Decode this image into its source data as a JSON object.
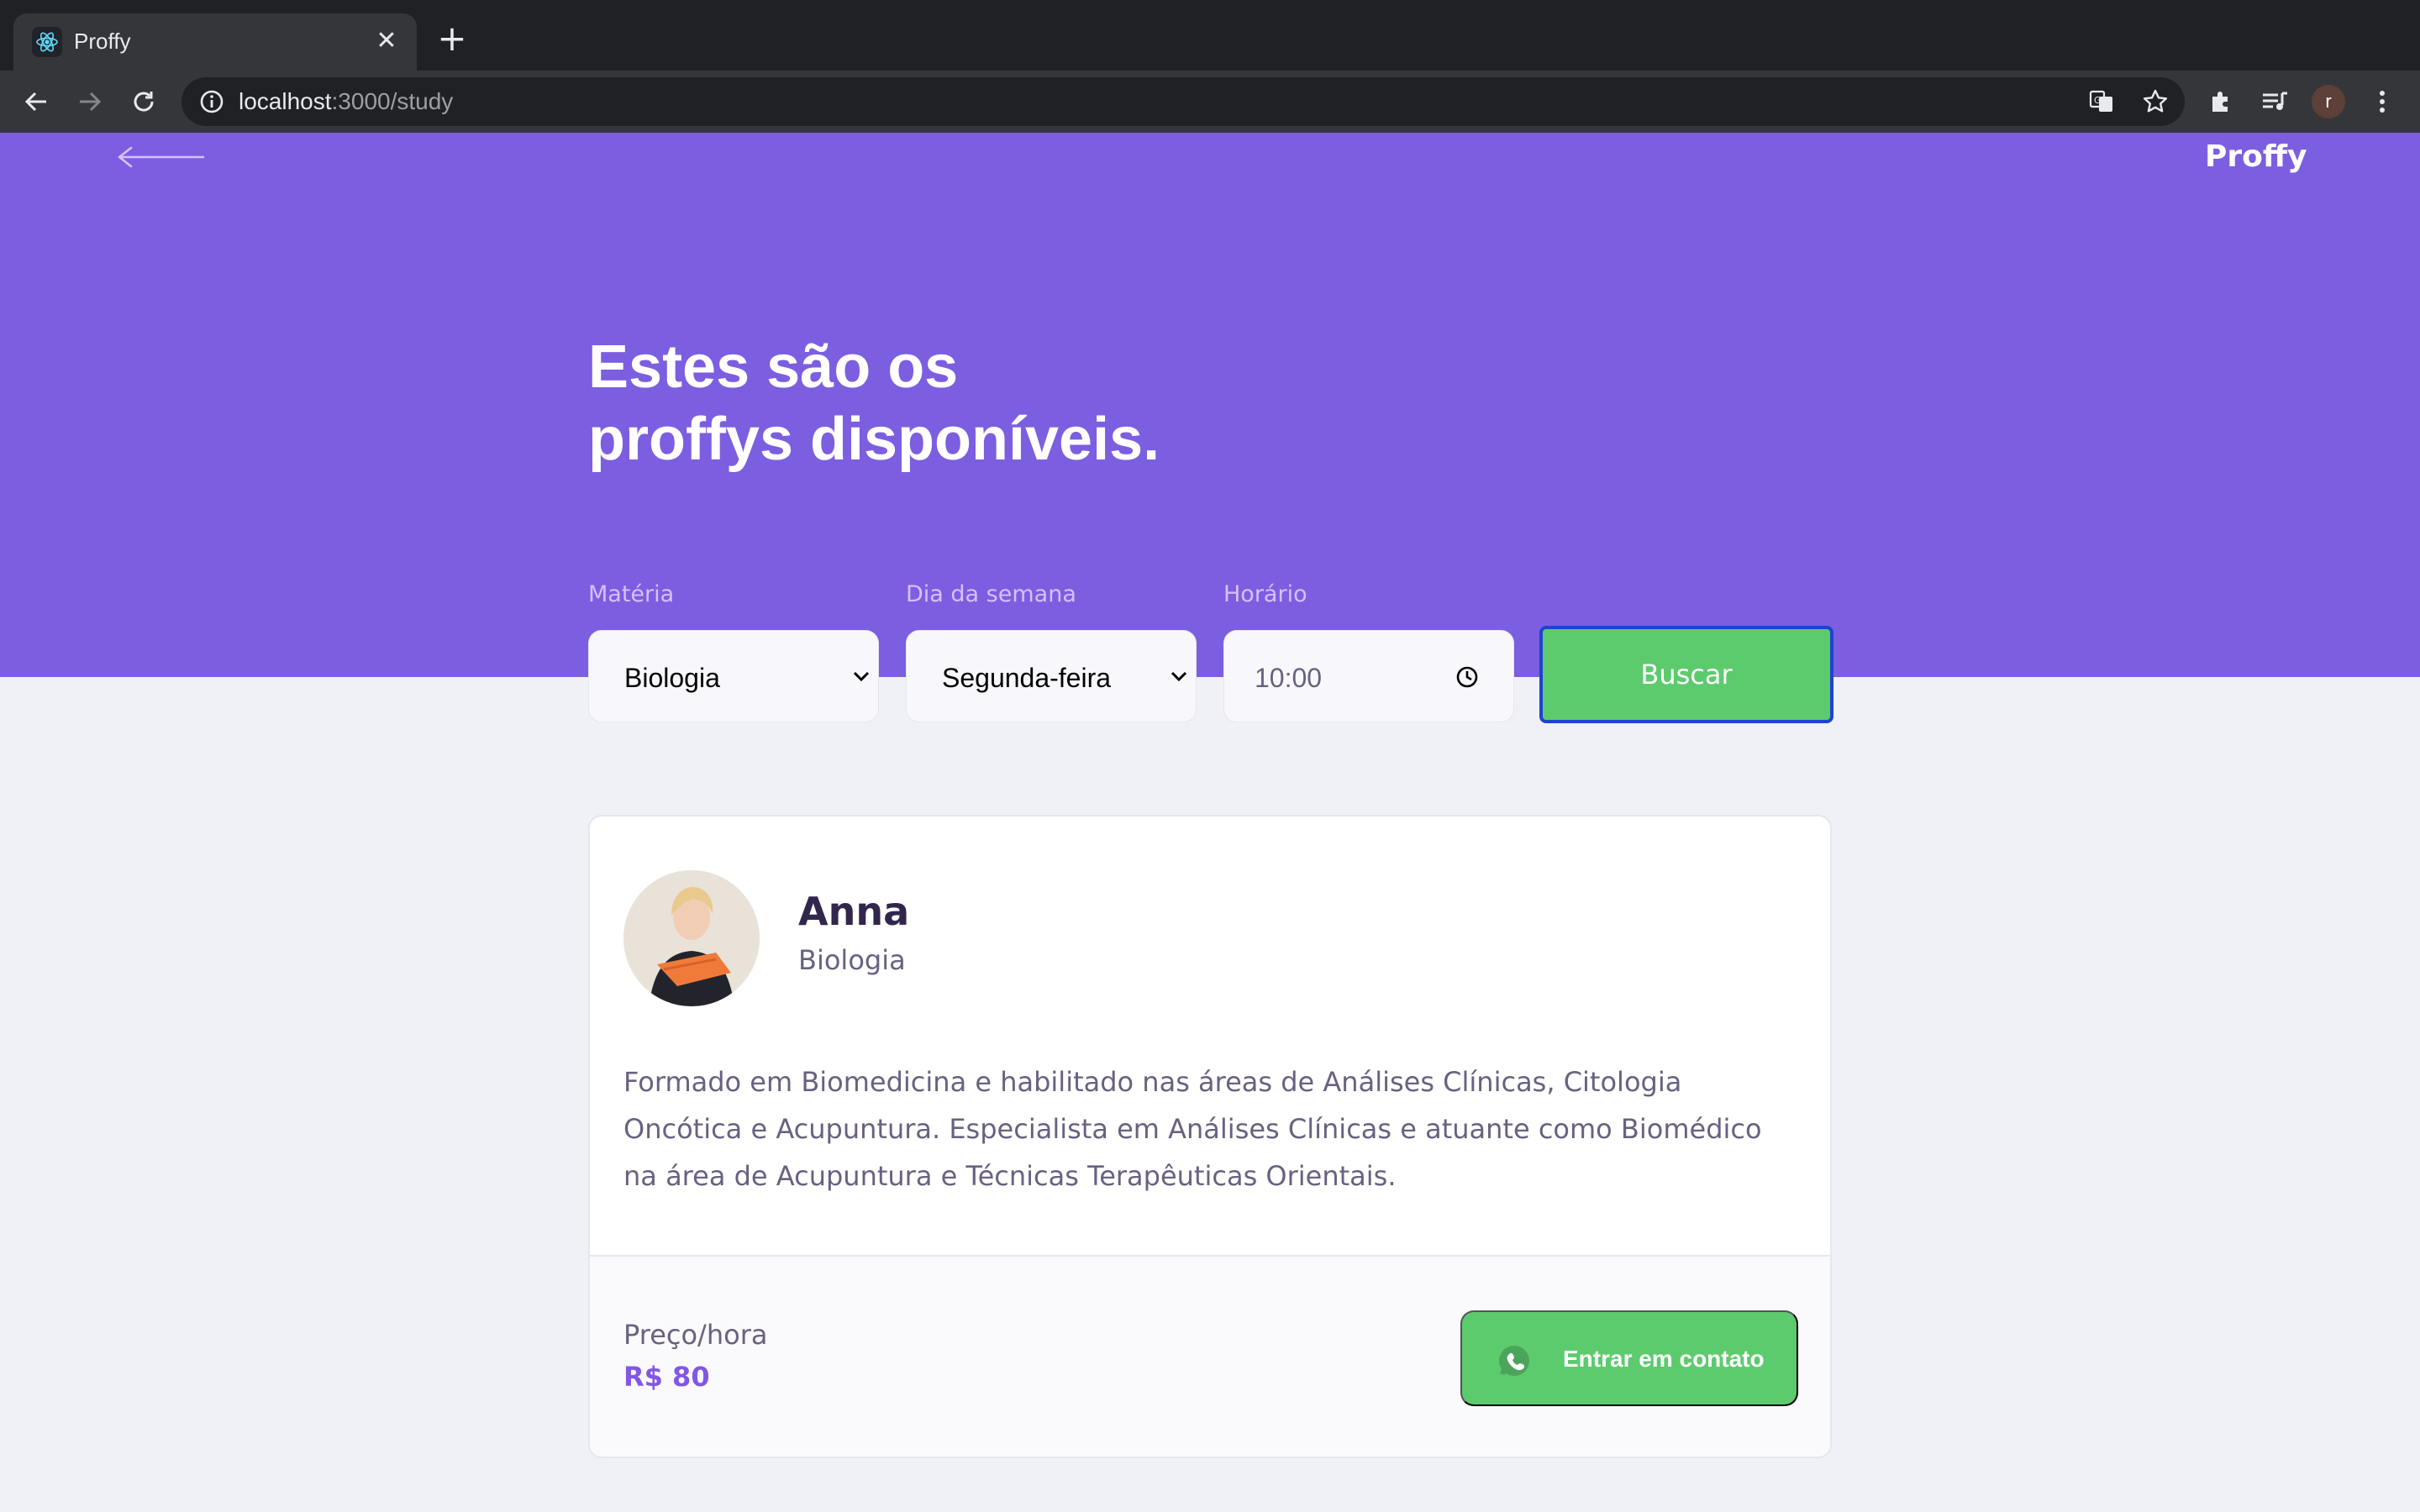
{
  "browser": {
    "tab_title": "Proffy",
    "tab_close_glyph": "✕",
    "new_tab_glyph": "+",
    "url_host": "localhost",
    "url_path": ":3000/study",
    "profile_initial": "r",
    "icons": [
      "react-favicon-icon",
      "back-icon",
      "forward-icon",
      "reload-icon",
      "info-icon",
      "translate-icon",
      "bookmark-star-icon",
      "extensions-icon",
      "media-queue-icon",
      "menu-dots-icon"
    ]
  },
  "header": {
    "logo": "Proffy",
    "back_icon": "back-arrow-icon"
  },
  "hero": {
    "title_line1": "Estes são os",
    "title_line2": "proffys disponíveis."
  },
  "filters": {
    "subject_label": "Matéria",
    "subject_value": "Biologia",
    "weekday_label": "Dia da semana",
    "weekday_value": "Segunda-feira",
    "time_label": "Horário",
    "time_value": "10:00",
    "search_button": "Buscar"
  },
  "teacher": {
    "name": "Anna",
    "subject": "Biologia",
    "bio": "Formado em Biomedicina e habilitado nas áreas de Análises Clínicas, Citologia Oncótica e Acupuntura. Especialista em Análises Clínicas e atuante como Biomédico na área de Acupuntura e Técnicas Terapêuticas Orientais.",
    "price_label": "Preço/hora",
    "price_value": "R$ 80",
    "contact_button": "Entrar em contato"
  },
  "colors": {
    "primary": "#7c5ee0",
    "secondary": "#5ccb6d",
    "background": "#f0f0f7",
    "text_title": "#32264d",
    "text_base": "#6a6180",
    "price": "#8257e5"
  }
}
